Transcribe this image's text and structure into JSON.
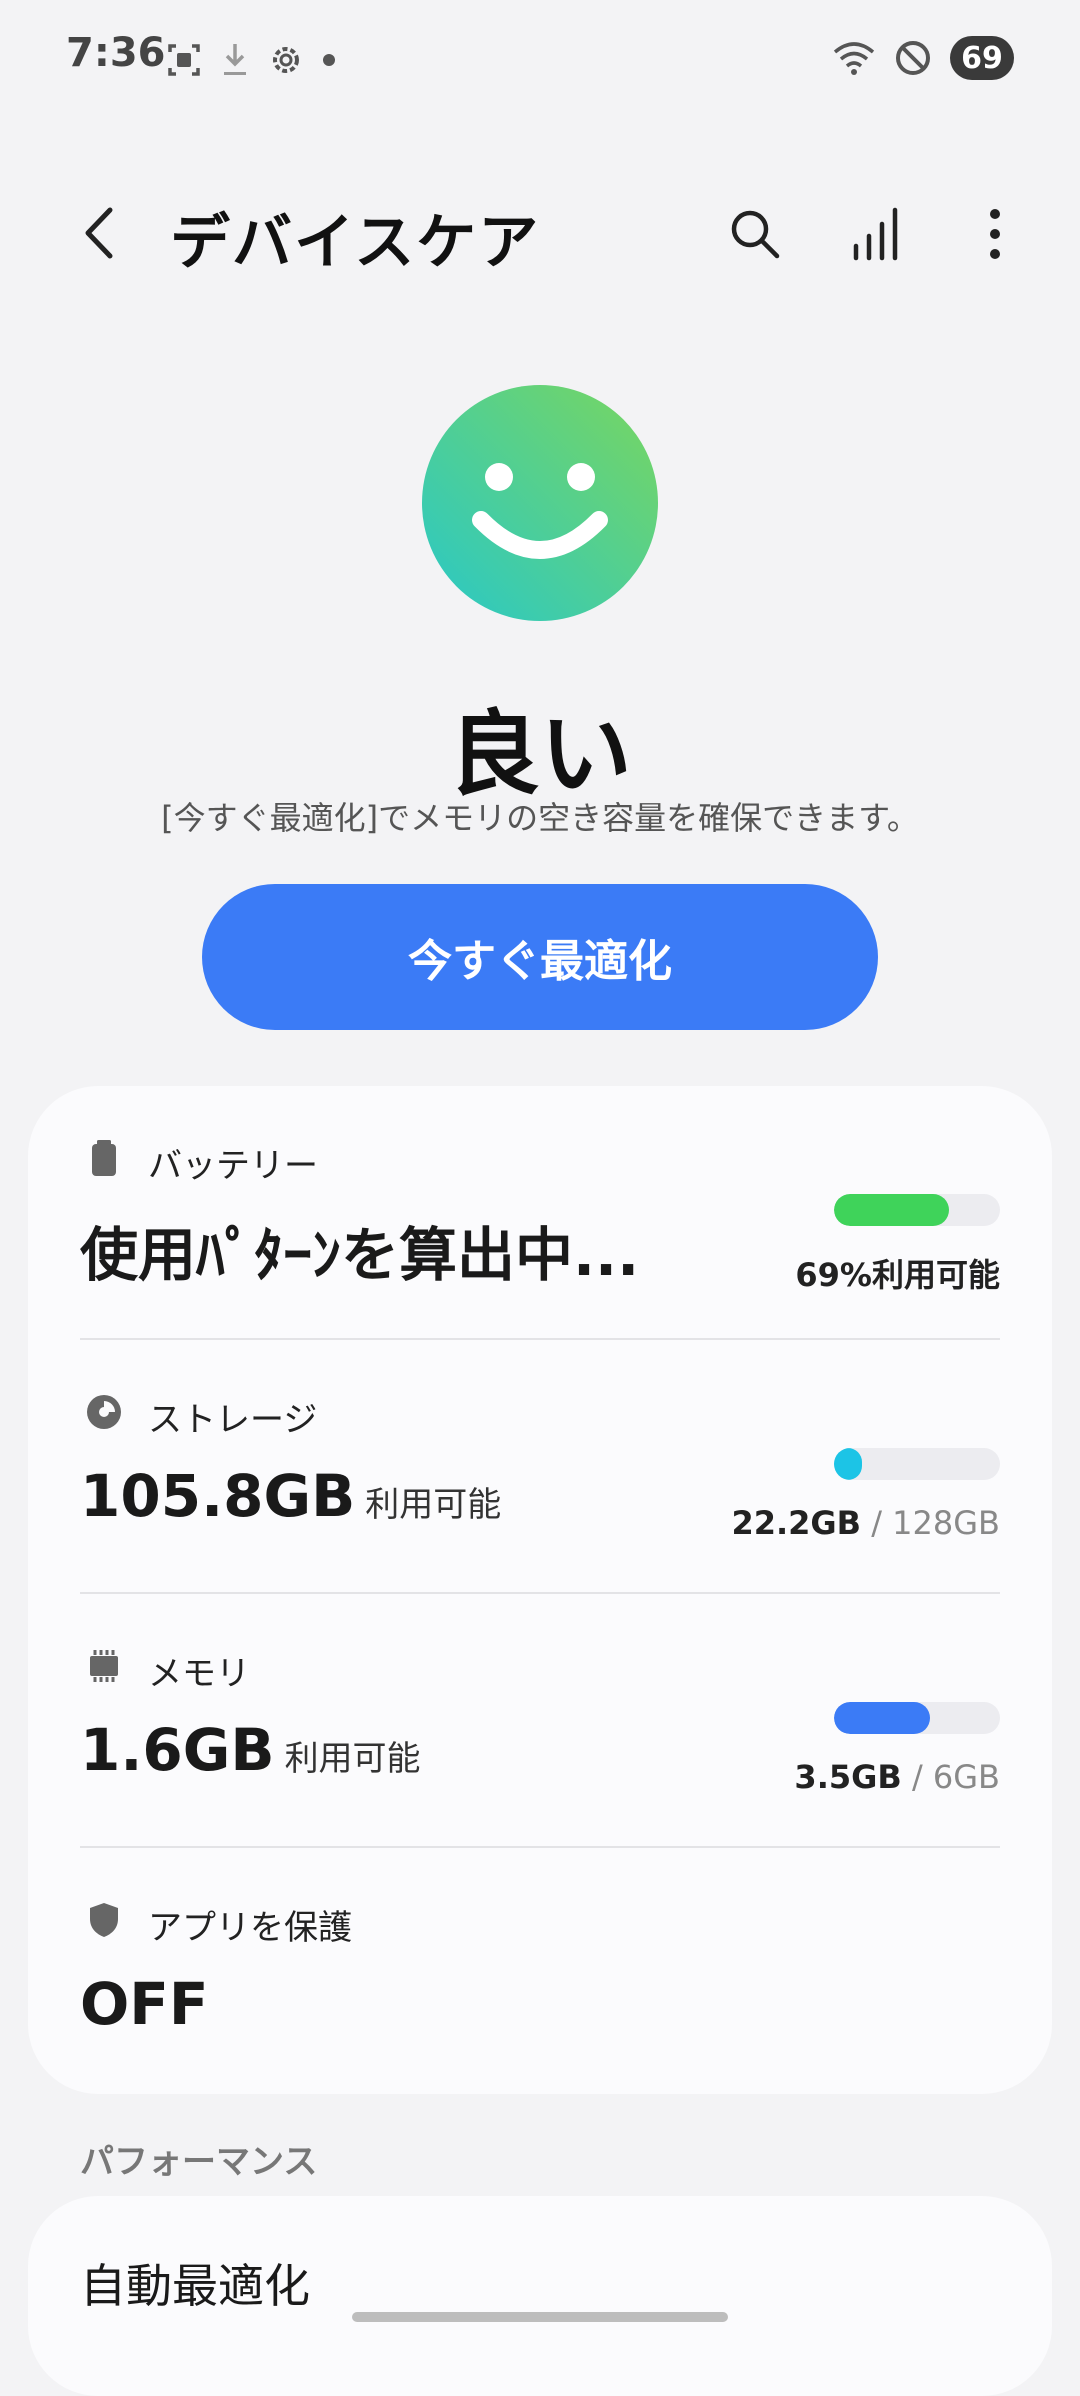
{
  "status_bar": {
    "time": "7:36",
    "battery": "69",
    "icons_left": [
      "screenshot-icon",
      "download-icon",
      "settings-icon",
      "dot-icon"
    ],
    "icons_right": [
      "wifi-icon",
      "do-not-disturb-icon"
    ]
  },
  "app_bar": {
    "title": "デバイスケア",
    "actions": [
      "search-icon",
      "chart-icon",
      "more-icon"
    ]
  },
  "summary": {
    "status": "良い",
    "description": "[今すぐ最適化]でメモリの空き容量を確保できます。",
    "button_label": "今すぐ最適化"
  },
  "battery": {
    "label": "バッテリー",
    "value": "使用ﾊﾟﾀｰﾝを算出中...",
    "right_text": "69%利用可能",
    "level": 0.69,
    "color": "#3fd35a"
  },
  "storage": {
    "label": "ストレージ",
    "value": "105.8GB",
    "unit": "利用可能",
    "used": "22.2GB",
    "separator": " / ",
    "total": "128GB",
    "level": 0.17,
    "color": "#1cc4e6"
  },
  "memory": {
    "label": "メモリ",
    "value": "1.6GB",
    "unit": "利用可能",
    "used": "3.5GB",
    "separator": " / ",
    "total": "6GB",
    "level": 0.58,
    "color": "#3b7bf6"
  },
  "app_protection": {
    "label": "アプリを保護",
    "value": "OFF"
  },
  "performance": {
    "header": "パフォーマンス",
    "auto_optimize": "自動最適化"
  }
}
